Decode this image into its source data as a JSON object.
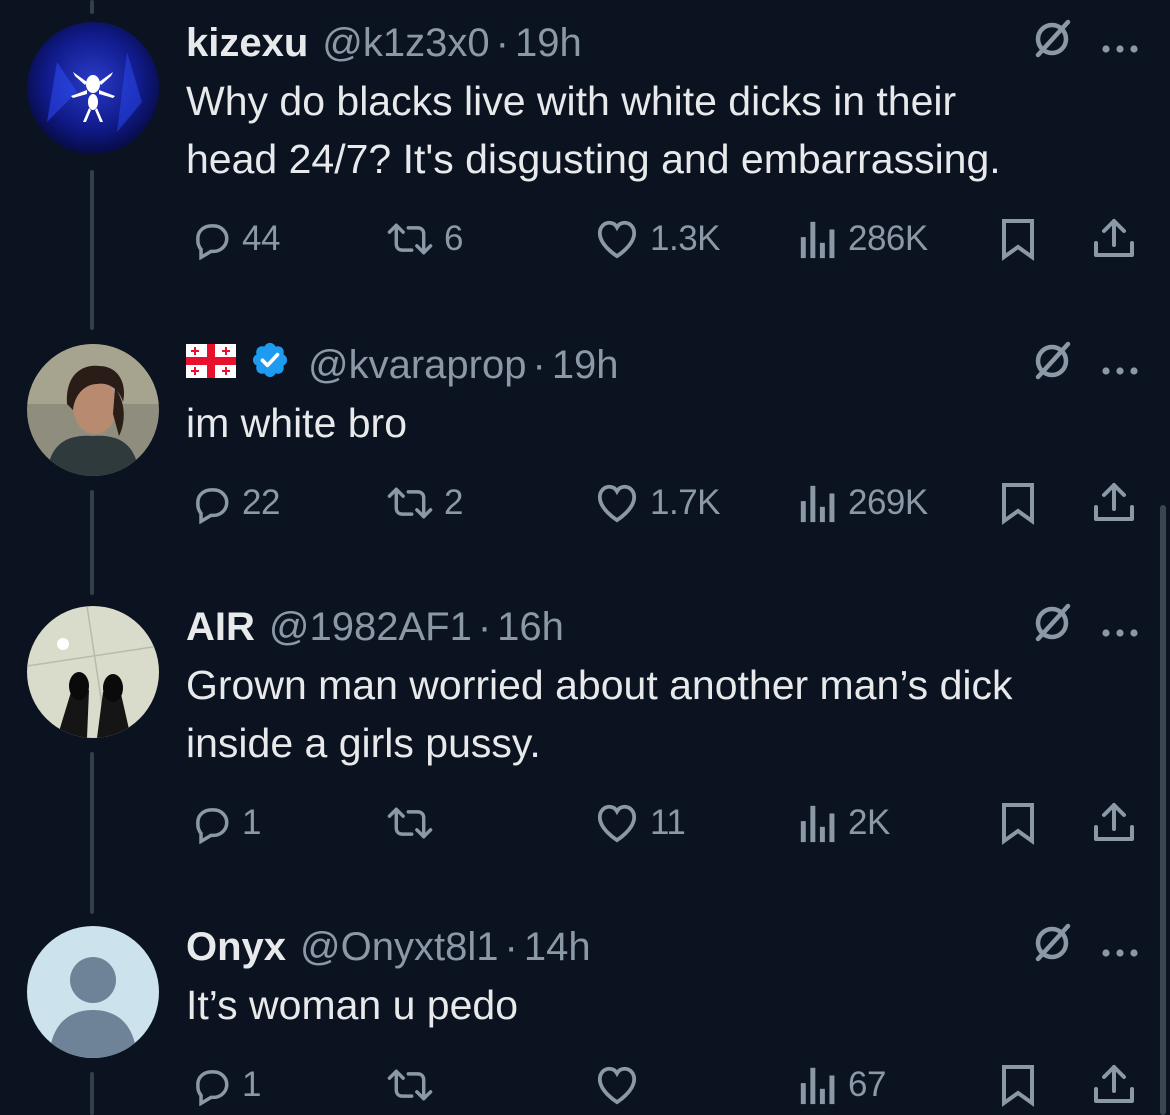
{
  "tweets": [
    {
      "display_name": "kizexu",
      "handle": "@k1z3x0",
      "time": "19h",
      "text": "Why do blacks live with white dicks in their\nhead 24/7? It's disgusting and embarrassing.",
      "replies": "44",
      "reposts": "6",
      "likes": "1.3K",
      "views": "286K"
    },
    {
      "display_name": "",
      "flag": "georgia-flag-icon",
      "verified": true,
      "handle": "@kvaraprop",
      "time": "19h",
      "text": "im white bro",
      "replies": "22",
      "reposts": "2",
      "likes": "1.7K",
      "views": "269K"
    },
    {
      "display_name": "AIR",
      "handle": "@1982AF1",
      "time": "16h",
      "text": "Grown man worried about another man’s dick\ninside a girls pussy.",
      "replies": "1",
      "reposts": "",
      "likes": "11",
      "views": "2K"
    },
    {
      "display_name": "Onyx",
      "handle": "@Onyxt8l1",
      "time": "14h",
      "text": "It’s woman u pedo",
      "replies": "1",
      "reposts": "",
      "likes": "",
      "views": "67"
    }
  ],
  "separator": "·",
  "icons": {
    "grok": "grok-icon",
    "more": "more-icon",
    "reply": "reply-icon",
    "repost": "repost-icon",
    "like": "heart-icon",
    "views": "views-icon",
    "bookmark": "bookmark-icon",
    "share": "share-icon",
    "verified": "verified-badge-icon"
  },
  "colors": {
    "background": "#0b1321",
    "text": "#e7e9ea",
    "muted": "#8b98a5",
    "verified": "#1d9bf0",
    "thread_line": "#333d4b"
  }
}
